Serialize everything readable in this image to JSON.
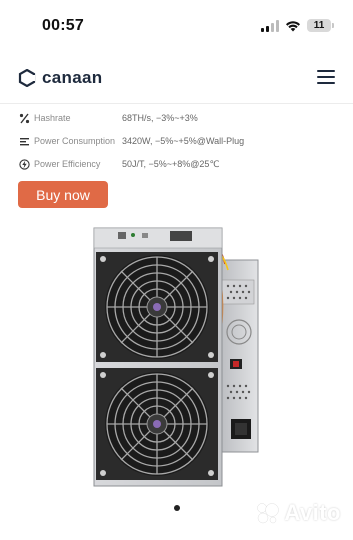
{
  "status_bar": {
    "time": "00:57",
    "battery": "11"
  },
  "header": {
    "brand": "canaan"
  },
  "specs": [
    {
      "icon": "hashrate-icon",
      "label": "Hashrate",
      "value": "68TH/s, −3%~+3%"
    },
    {
      "icon": "power-consumption-icon",
      "label": "Power Consumption",
      "value": "3420W, −5%~+5%@Wall-Plug"
    },
    {
      "icon": "power-efficiency-icon",
      "label": "Power Efficiency",
      "value": "50J/T, −5%~+8%@25℃"
    }
  ],
  "buy_button": {
    "label": "Buy now"
  },
  "colors": {
    "accent": "#e06a46",
    "brand": "#1e2a3d"
  },
  "watermark": {
    "text": "Avito"
  }
}
